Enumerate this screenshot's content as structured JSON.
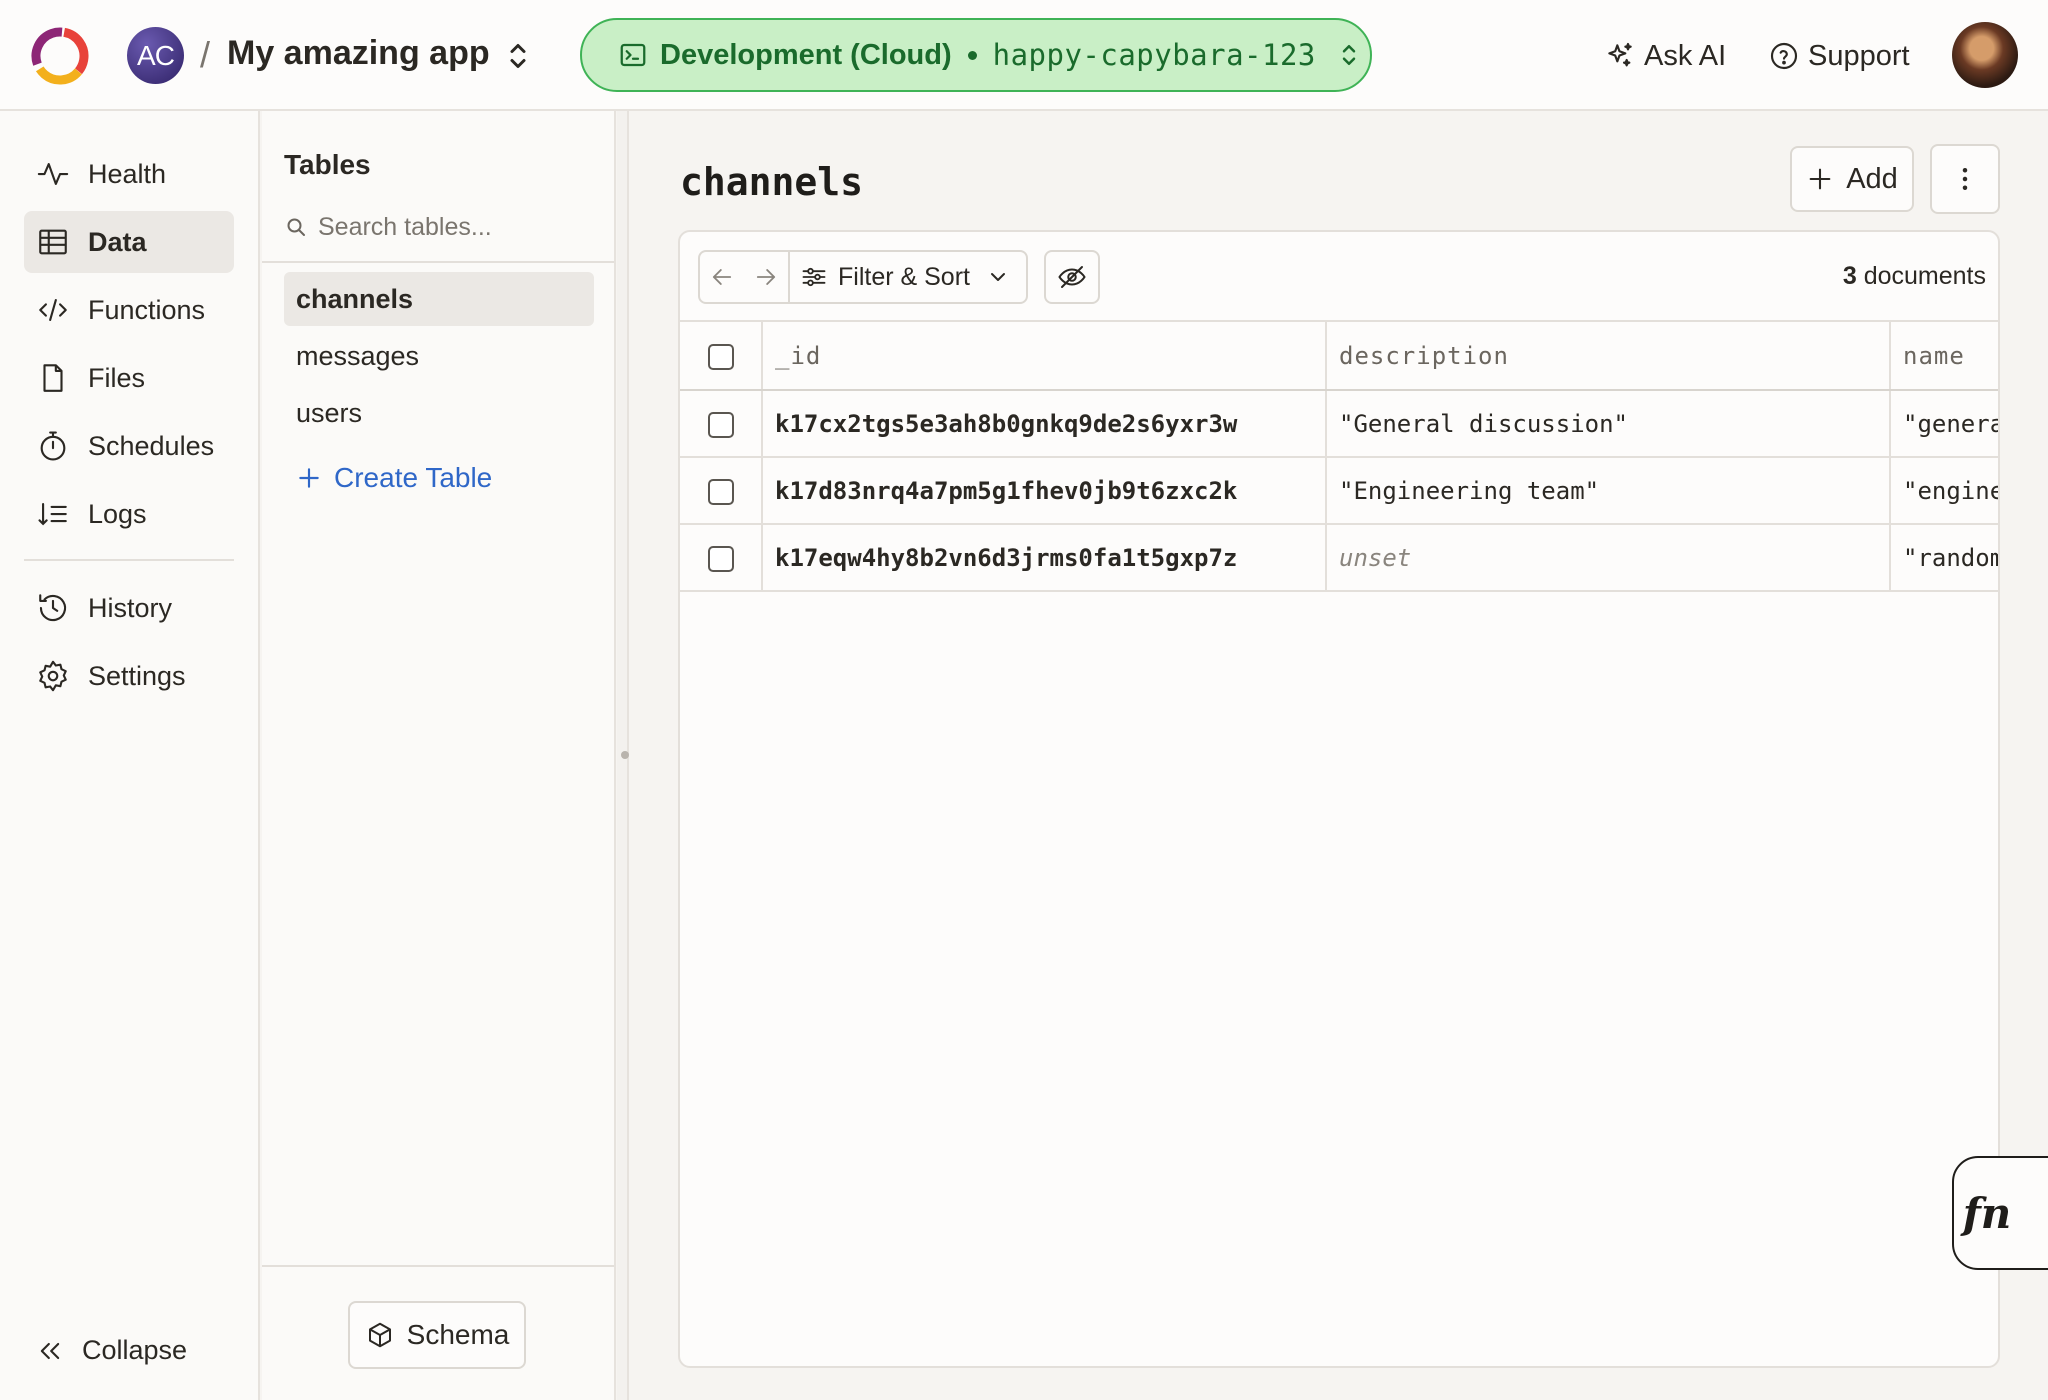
{
  "header": {
    "team_initials": "AC",
    "separator": "/",
    "app_name": "My amazing app",
    "deployment_env": "Development (Cloud)",
    "deployment_slug": "happy-capybara-123",
    "ask_ai_label": "Ask AI",
    "support_label": "Support"
  },
  "nav": {
    "items": [
      {
        "label": "Health",
        "icon": "activity-icon"
      },
      {
        "label": "Data",
        "icon": "table-icon",
        "active": true
      },
      {
        "label": "Functions",
        "icon": "code-icon"
      },
      {
        "label": "Files",
        "icon": "file-icon"
      },
      {
        "label": "Schedules",
        "icon": "stopwatch-icon"
      },
      {
        "label": "Logs",
        "icon": "logs-icon"
      },
      {
        "label": "History",
        "icon": "history-icon"
      },
      {
        "label": "Settings",
        "icon": "gear-icon"
      }
    ],
    "collapse_label": "Collapse"
  },
  "tables_panel": {
    "title": "Tables",
    "search_placeholder": "Search tables...",
    "tables": [
      "channels",
      "messages",
      "users"
    ],
    "active_table": "channels",
    "create_label": "Create Table",
    "schema_label": "Schema"
  },
  "main": {
    "title": "channels",
    "add_label": "Add",
    "filter_label": "Filter & Sort",
    "doc_count": "3",
    "doc_count_suffix": "documents",
    "columns": [
      "_id",
      "description",
      "name"
    ],
    "rows": [
      {
        "_id": "k17cx2tgs5e3ah8b0gnkq9de2s6yxr3w",
        "description": "\"General discussion\"",
        "name": "\"general\""
      },
      {
        "_id": "k17d83nrq4a7pm5g1fhev0jb9t6zxc2k",
        "description": "\"Engineering team\"",
        "name": "\"engineering\""
      },
      {
        "_id": "k17eqw4hy8b2vn6d3jrms0fa1t5gxp7z",
        "description": "unset",
        "name": "\"random\""
      }
    ],
    "fn_label": "fn"
  },
  "colors": {
    "accent_blue": "#2f67c8",
    "deploy_green_bg": "#c9efc6",
    "deploy_green_text": "#1a6b2c"
  }
}
